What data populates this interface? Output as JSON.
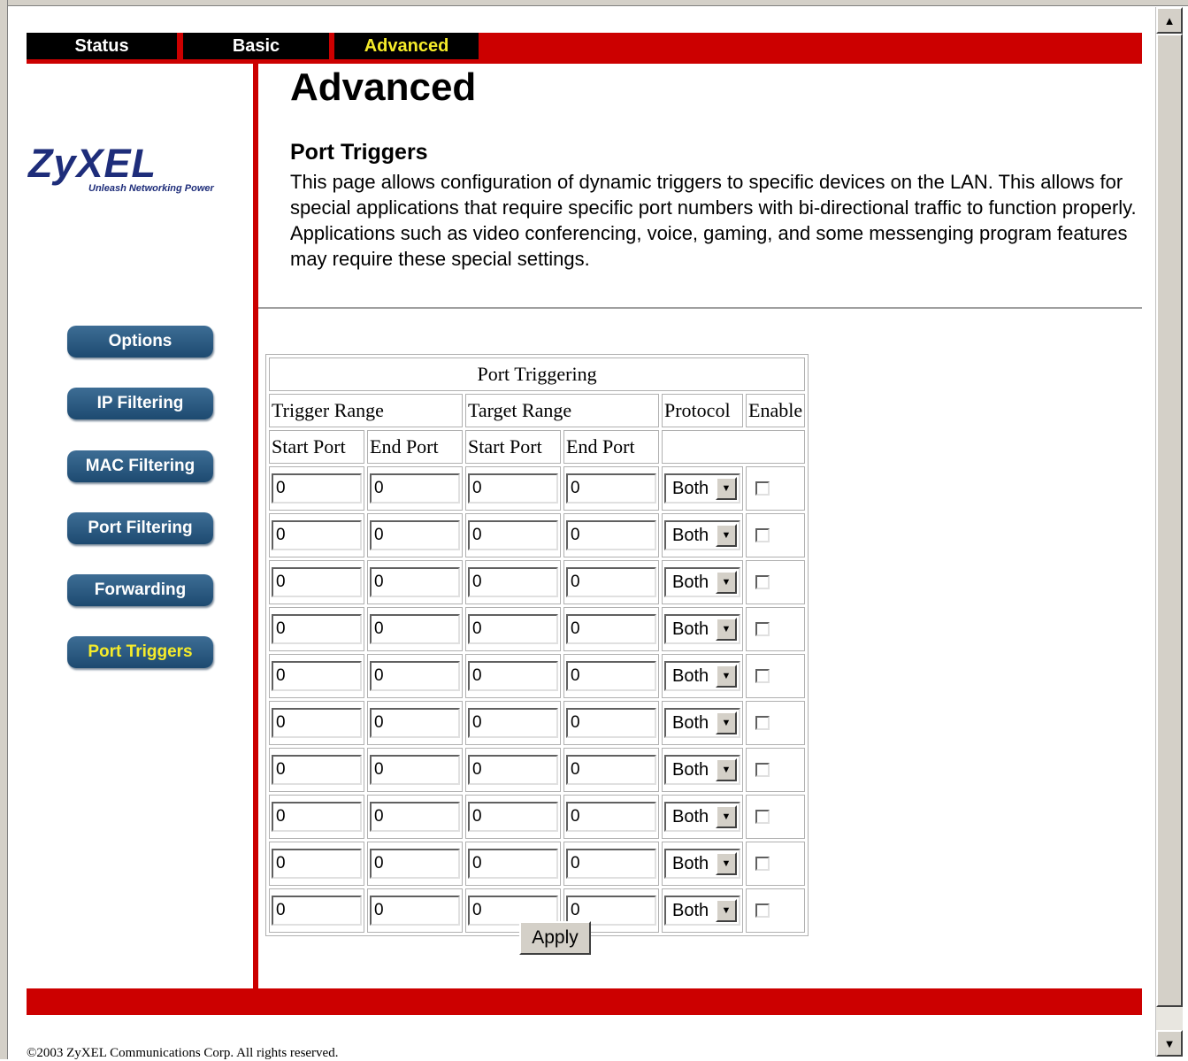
{
  "nav": {
    "tabs": [
      {
        "label": "Status"
      },
      {
        "label": "Basic"
      },
      {
        "label": "Advanced"
      }
    ]
  },
  "logo": {
    "name": "ZyXEL",
    "tagline": "Unleash Networking Power"
  },
  "sidebar": {
    "items": [
      {
        "label": "Options"
      },
      {
        "label": "IP Filtering"
      },
      {
        "label": "MAC Filtering"
      },
      {
        "label": "Port Filtering"
      },
      {
        "label": "Forwarding"
      },
      {
        "label": "Port Triggers"
      }
    ]
  },
  "main": {
    "title": "Advanced",
    "section_title": "Port Triggers",
    "description": "This page allows configuration of dynamic triggers to specific devices on the LAN. This allows for special applications that require specific port numbers with bi-directional traffic to function properly. Applications such as video conferencing, voice, gaming, and some messenging program features may require these special settings."
  },
  "table": {
    "caption": "Port Triggering",
    "group_headers": {
      "trigger": "Trigger Range",
      "target": "Target Range",
      "protocol": "Protocol",
      "enable": "Enable"
    },
    "sub_headers": {
      "trigger_start": "Start Port",
      "trigger_end": "End Port",
      "target_start": "Start Port",
      "target_end": "End Port"
    },
    "rows": [
      {
        "trigger_start": "0",
        "trigger_end": "0",
        "target_start": "0",
        "target_end": "0",
        "protocol": "Both",
        "enabled": false
      },
      {
        "trigger_start": "0",
        "trigger_end": "0",
        "target_start": "0",
        "target_end": "0",
        "protocol": "Both",
        "enabled": false
      },
      {
        "trigger_start": "0",
        "trigger_end": "0",
        "target_start": "0",
        "target_end": "0",
        "protocol": "Both",
        "enabled": false
      },
      {
        "trigger_start": "0",
        "trigger_end": "0",
        "target_start": "0",
        "target_end": "0",
        "protocol": "Both",
        "enabled": false
      },
      {
        "trigger_start": "0",
        "trigger_end": "0",
        "target_start": "0",
        "target_end": "0",
        "protocol": "Both",
        "enabled": false
      },
      {
        "trigger_start": "0",
        "trigger_end": "0",
        "target_start": "0",
        "target_end": "0",
        "protocol": "Both",
        "enabled": false
      },
      {
        "trigger_start": "0",
        "trigger_end": "0",
        "target_start": "0",
        "target_end": "0",
        "protocol": "Both",
        "enabled": false
      },
      {
        "trigger_start": "0",
        "trigger_end": "0",
        "target_start": "0",
        "target_end": "0",
        "protocol": "Both",
        "enabled": false
      },
      {
        "trigger_start": "0",
        "trigger_end": "0",
        "target_start": "0",
        "target_end": "0",
        "protocol": "Both",
        "enabled": false
      },
      {
        "trigger_start": "0",
        "trigger_end": "0",
        "target_start": "0",
        "target_end": "0",
        "protocol": "Both",
        "enabled": false
      }
    ]
  },
  "apply_label": "Apply",
  "footer": {
    "copyright": "©2003 ZyXEL Communications Corp.   All rights reserved."
  },
  "colors": {
    "brand_red": "#cc0000",
    "nav_black": "#000000",
    "active_yellow": "#f6ec2a",
    "sidebar_blue": "#2a5a82",
    "logo_blue": "#1e2d7a"
  },
  "icons": {
    "scroll_up": "scroll-up-arrow-icon",
    "scroll_down": "scroll-down-arrow-icon",
    "dropdown": "chevron-down-icon"
  }
}
